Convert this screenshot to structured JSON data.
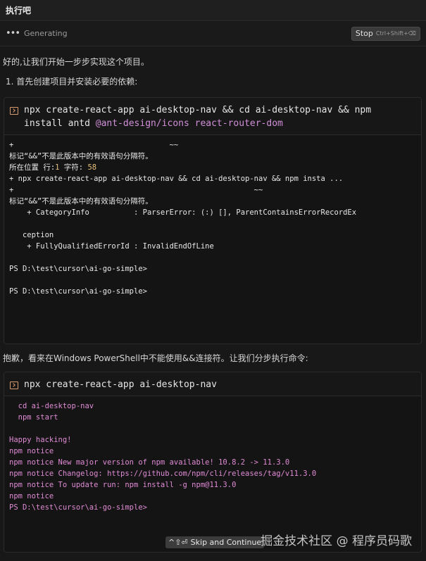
{
  "header": {
    "title": "执行吧"
  },
  "generating": {
    "icon": "ellipsis-icon",
    "label": "Generating",
    "stop_label": "Stop",
    "stop_shortcut": "Ctrl+Shift+⌫"
  },
  "messages": {
    "intro": "好的,让我们开始一步步实现这个项目。",
    "step1": "1. 首先创建项目并安装必要的依赖:",
    "apology": "抱歉，看来在Windows PowerShell中不能使用&&连接符。让我们分步执行命令:"
  },
  "terminal1": {
    "icon": "terminal-icon",
    "cmd_line1": "npx create-react-app ai-desktop-nav && cd ai-desktop-nav && npm",
    "cmd_line2_pre": "install antd ",
    "cmd_line2_at": "@ant-design/icons react-router-dom",
    "out": {
      "l1": "+                                   ~~",
      "l2": "标记“&&”不是此版本中的有效语句分隔符。",
      "l3_pre": "所在位置 行:",
      "l3_n1": "1",
      "l3_mid": " 字符: ",
      "l3_n2": "58",
      "l4": "+ npx create-react-app ai-desktop-nav && cd ai-desktop-nav && npm insta ...",
      "l5": "+                                                      ~~",
      "l6": "标记“&&”不是此版本中的有效语句分隔符。",
      "l7": "    + CategoryInfo          : ParserError: (:) [], ParentContainsErrorRecordEx",
      "l8": "",
      "l9": "   ception",
      "l10": "    + FullyQualifiedErrorId : InvalidEndOfLine",
      "l11": "",
      "l12": "PS D:\\test\\cursor\\ai-go-simple>",
      "l13": "",
      "l14": "PS D:\\test\\cursor\\ai-go-simple>"
    }
  },
  "terminal2": {
    "icon": "terminal-icon",
    "cmd": "npx create-react-app ai-desktop-nav",
    "out": {
      "l1": "  cd ai-desktop-nav",
      "l2": "  npm start",
      "l3": "",
      "l4": "Happy hacking!",
      "l5": "npm notice",
      "l6": "npm notice New major version of npm available! 10.8.2 -> 11.3.0",
      "l7": "npm notice Changelog: https://github.com/npm/cli/releases/tag/v11.3.0",
      "l8": "npm notice To update run: npm install -g npm@11.3.0",
      "l9": "npm notice",
      "l10": "PS D:\\test\\cursor\\ai-go-simple>"
    }
  },
  "toast": {
    "shortcut": "^⇧⏎",
    "label": "Skip and Continue"
  },
  "watermark": "掘金技术社区 @ 程序员码歌"
}
